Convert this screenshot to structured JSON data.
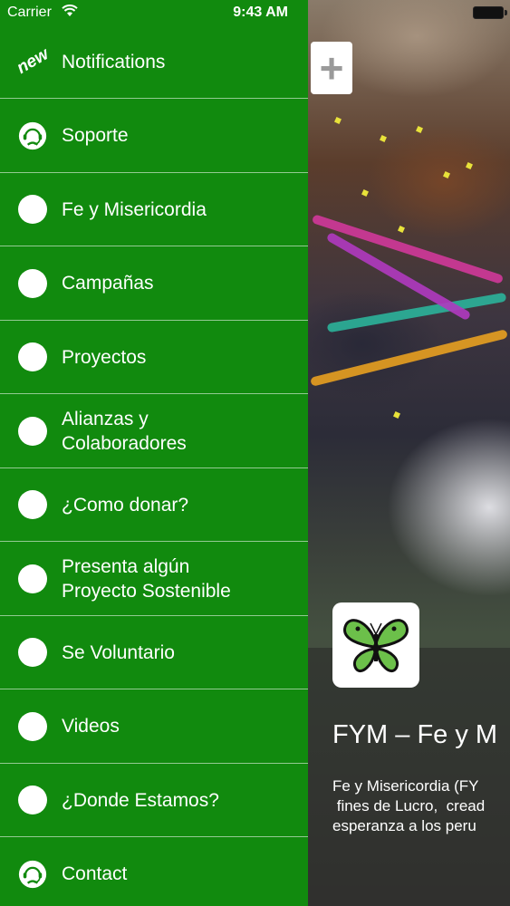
{
  "status_bar": {
    "carrier": "Carrier",
    "time": "9:43 AM",
    "wifi_icon": "wifi-icon",
    "battery_icon": "battery-icon"
  },
  "menu": {
    "items": [
      {
        "label": "Notifications",
        "icon": "new-badge-icon",
        "icon_text": "new"
      },
      {
        "label": "Soporte",
        "icon": "support-agent-icon"
      },
      {
        "label": "Fe y Misericordia",
        "icon": "dot-icon"
      },
      {
        "label": "Campañas",
        "icon": "dot-icon"
      },
      {
        "label": "Proyectos",
        "icon": "dot-icon"
      },
      {
        "label": "Alianzas y\nColaboradores",
        "icon": "dot-icon"
      },
      {
        "label": "¿Como donar?",
        "icon": "dot-icon"
      },
      {
        "label": "Presenta algún\nProyecto Sostenible",
        "icon": "dot-icon"
      },
      {
        "label": "Se Voluntario",
        "icon": "dot-icon"
      },
      {
        "label": "Videos",
        "icon": "dot-icon"
      },
      {
        "label": "¿Donde Estamos?",
        "icon": "dot-icon"
      },
      {
        "label": "Contact",
        "icon": "support-agent-icon"
      }
    ]
  },
  "content": {
    "add_label": "+",
    "title": "FYM – Fe y M",
    "description": "Fe y Misericordia (FY\n fines de Lucro,  cread\nesperanza a los peru",
    "logo_icon": "butterfly-icon"
  },
  "colors": {
    "menu_bg": "#118a0e",
    "butterfly_green": "#6cc04a"
  }
}
